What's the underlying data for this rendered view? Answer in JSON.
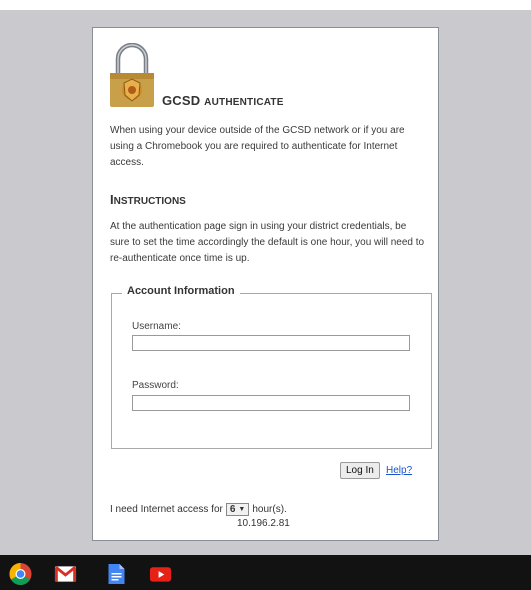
{
  "page": {
    "title_big": "GCSD ",
    "title_small": "Authenticate",
    "intro": "When using your device outside of the GCSD network or if you are using a Chromebook you are required to authenticate for Internet access.",
    "section_big": "I",
    "section_small": "nstructions",
    "instructions": "At the authentication page sign in using your district credentials, be sure to set the time accordingly the default is one hour, you will need to re-authenticate once time is up."
  },
  "form": {
    "legend": "Account Information",
    "username_label": "Username:",
    "username_value": "",
    "password_label": "Password:",
    "password_value": "",
    "login_label": "Log In",
    "help_label": "Help?",
    "access_prefix": "I need Internet access for",
    "hours_value": "6",
    "access_suffix": "hour(s).",
    "ip_address": "10.196.2.81"
  },
  "shelf": {
    "apps": [
      {
        "icon": "chrome-icon"
      },
      {
        "icon": "gmail-icon"
      },
      {
        "icon": "docs-icon"
      },
      {
        "icon": "youtube-icon"
      }
    ]
  },
  "colors": {
    "page_background": "#c9c9ce",
    "shelf": "#121212",
    "link": "#1a55cc",
    "lock_gold": "#c9a04a"
  }
}
